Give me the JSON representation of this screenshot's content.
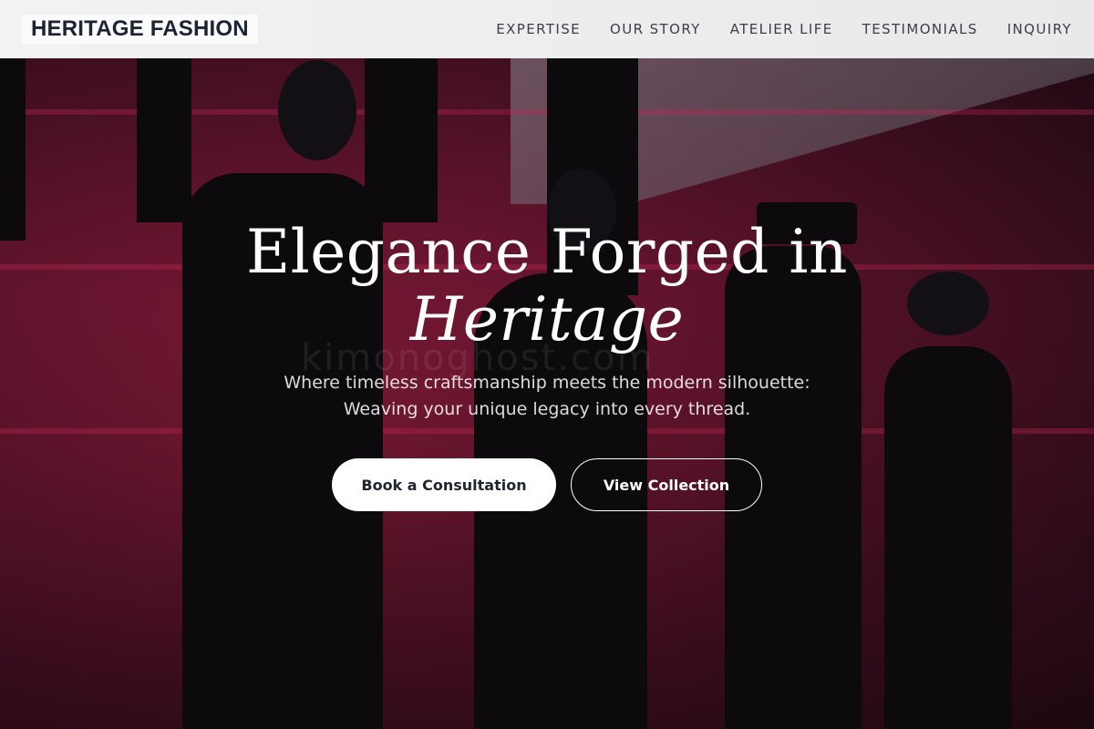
{
  "brand": {
    "name": "HERITAGE FASHION"
  },
  "nav": {
    "items": [
      {
        "label": "EXPERTISE"
      },
      {
        "label": "OUR STORY"
      },
      {
        "label": "ATELIER LIFE"
      },
      {
        "label": "TESTIMONIALS"
      },
      {
        "label": "INQUIRY"
      }
    ]
  },
  "hero": {
    "title_line1": "Elegance Forged in",
    "title_line2": "Heritage",
    "subtitle_line1": "Where timeless craftsmanship meets the modern silhouette:",
    "subtitle_line2": "Weaving your unique legacy into every thread.",
    "watermark": "kimonoghost.com",
    "primary_button": "Book a Consultation",
    "secondary_button": "View Collection"
  },
  "colors": {
    "accent": "#8a1c3a",
    "text_dark": "#1c2433",
    "button_bg": "#ffffff"
  }
}
